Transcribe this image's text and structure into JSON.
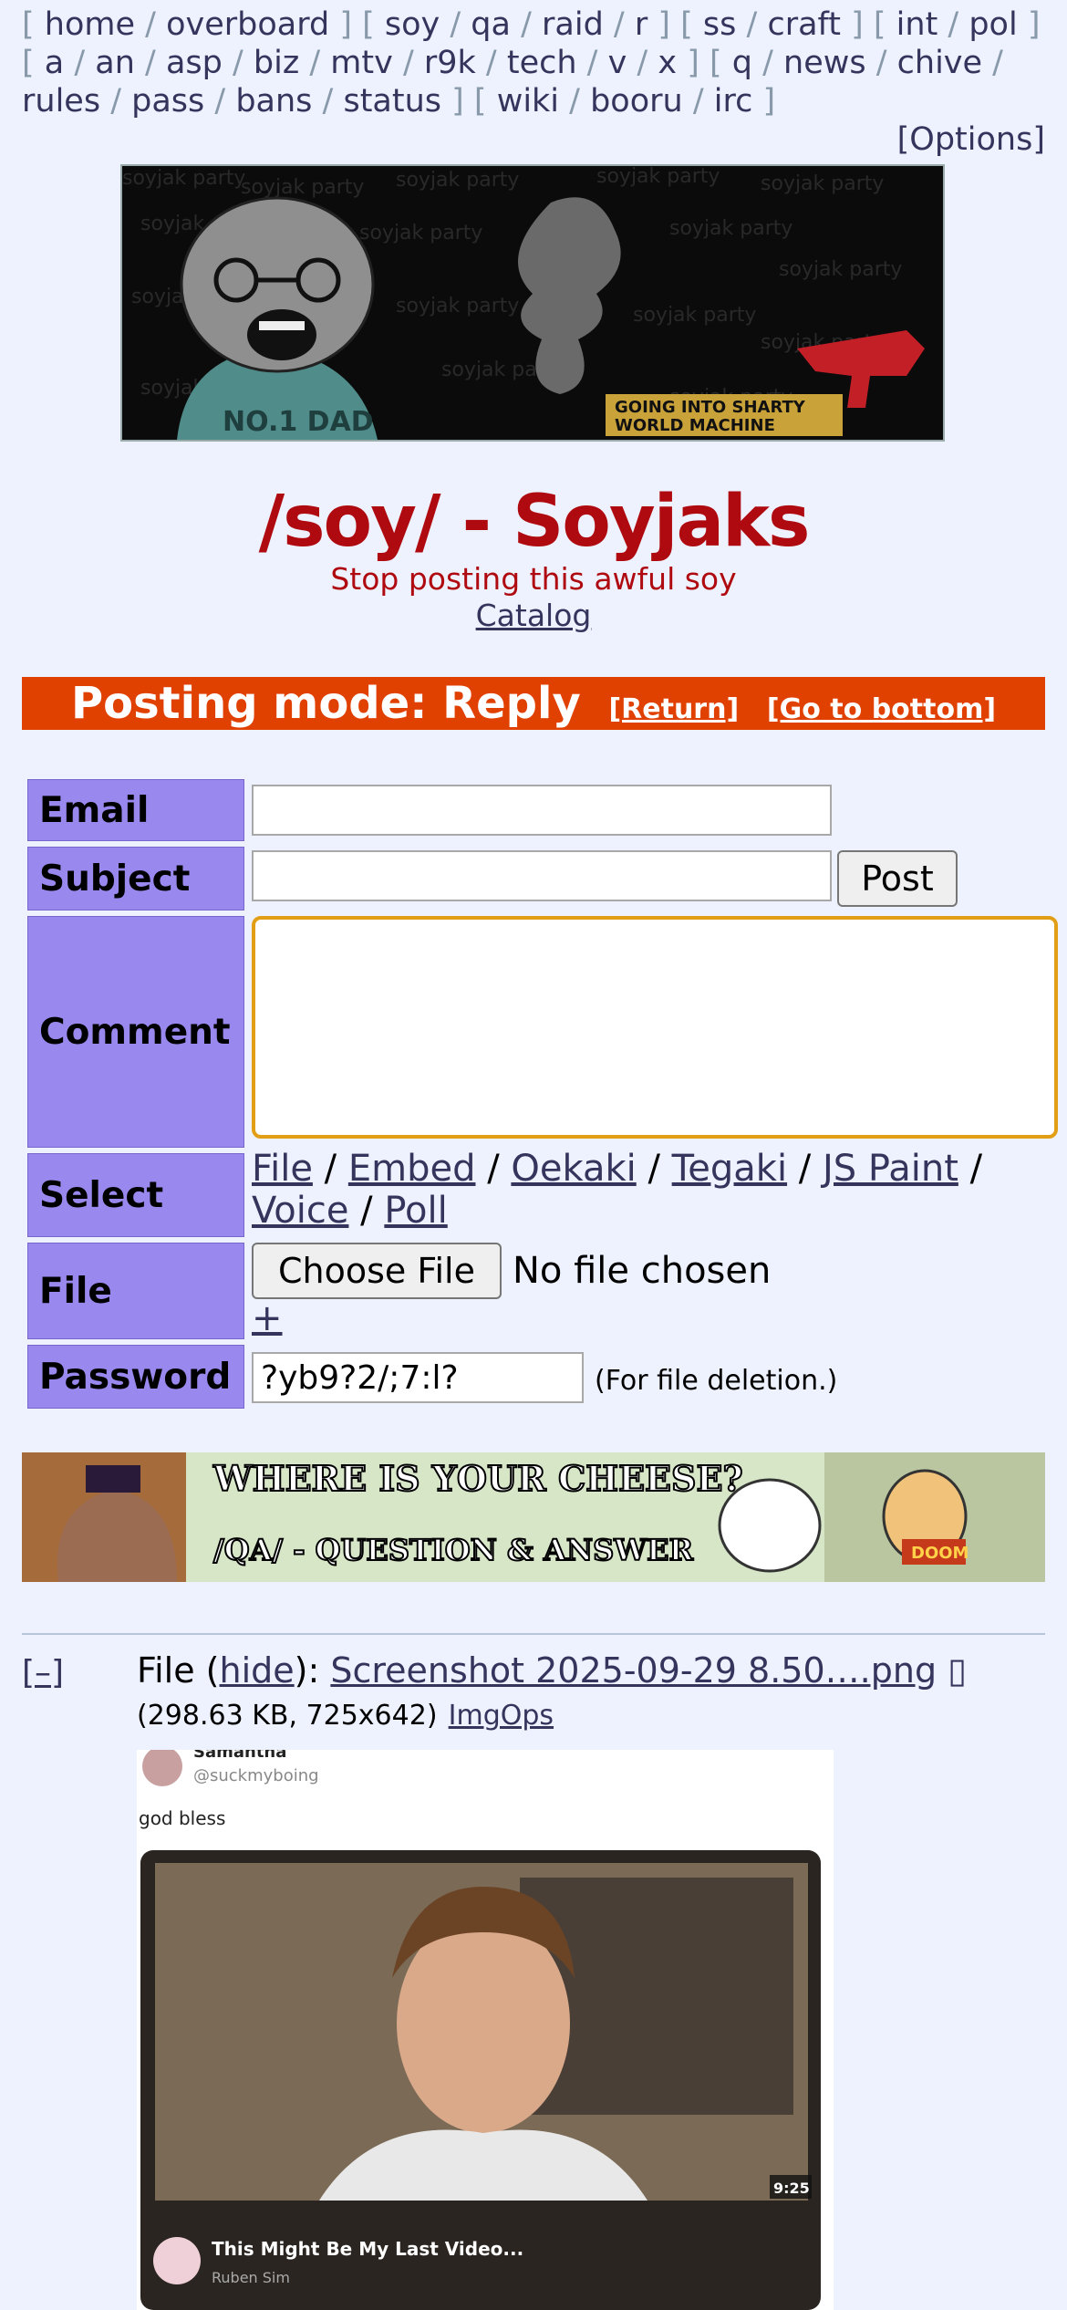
{
  "boardlist": {
    "groups": [
      [
        "home",
        "overboard"
      ],
      [
        "soy",
        "qa",
        "raid",
        "r"
      ],
      [
        "ss",
        "craft"
      ],
      [
        "int",
        "pol"
      ],
      [
        "a",
        "an",
        "asp",
        "biz",
        "mtv",
        "r9k",
        "tech",
        "v",
        "x"
      ],
      [
        "q",
        "news",
        "chive",
        "rules",
        "pass",
        "bans",
        "status"
      ],
      [
        "wiki",
        "booru",
        "irc"
      ]
    ],
    "options_label": "[Options]"
  },
  "banner": {
    "caption_line1": "GOING INTO SHARTY",
    "caption_line2": "WORLD MACHINE",
    "shirt_text": "NO.1 DAD",
    "bg_text": "soyjak party"
  },
  "board": {
    "title": "/soy/ - Soyjaks",
    "subtitle": "Stop posting this awful soy",
    "catalog_label": "Catalog"
  },
  "posting_mode": {
    "label": "Posting mode: Reply",
    "return_label": "[Return]",
    "bottom_label": "[Go to bottom]",
    "color": "#e04000"
  },
  "form": {
    "email_label": "Email",
    "subject_label": "Subject",
    "comment_label": "Comment",
    "select_label": "Select",
    "file_label": "File",
    "password_label": "Password",
    "post_button": "Post",
    "select_options": [
      "File",
      "Embed",
      "Oekaki",
      "Tegaki",
      "JS Paint",
      "Voice",
      "Poll"
    ],
    "choose_file_button": "Choose File",
    "no_file_text": "No file chosen",
    "add_file": "+",
    "password_value": "?yb9?2/;7:l?",
    "password_hint": "(For file deletion.)",
    "label_bg": "#9988ee",
    "focus_color": "#e29f15"
  },
  "ad": {
    "line1": "WHERE IS YOUR CHEESE?",
    "line2": "/QA/ - QUESTION & ANSWER",
    "badge": "DOOM"
  },
  "post": {
    "collapse_label": "[–]",
    "file_prefix": "File (",
    "hide_label": "hide",
    "file_suffix": "): ",
    "filename": "Screenshot 2025-09-29 8.50….png",
    "file_glyph": "▯",
    "file_meta": "(298.63 KB, 725x642)",
    "imgops_label": "ImgOps",
    "image": {
      "user_name": "Samantha",
      "user_handle": "@suckmyboing",
      "post_text": "god bless",
      "duration": "9:25",
      "video_title": "This Might Be My Last Video...",
      "channel": "Ruben Sim"
    }
  }
}
